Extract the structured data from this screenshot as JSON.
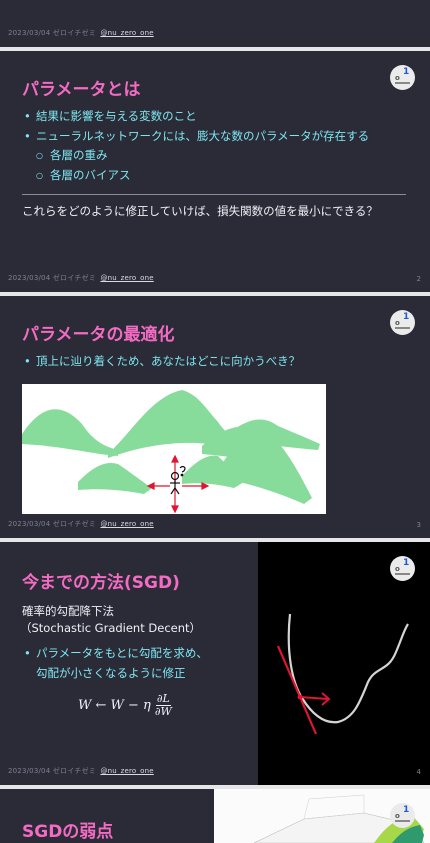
{
  "footer": {
    "date": "2023/03/04",
    "org": "ゼロイチゼミ",
    "handle": "@nu_zero_one"
  },
  "slide2": {
    "title": "パラメータとは",
    "bullets": [
      "結果に影響を与える変数のこと",
      "ニューラルネットワークには、膨大な数のパラメータが存在する"
    ],
    "subbullets": [
      "各層の重み",
      "各層のバイアス"
    ],
    "question": "これらをどのように修正していけば、損失関数の値を最小にできる？",
    "page": "2"
  },
  "slide3": {
    "title": "パラメータの最適化",
    "bullet": "頂上に辿り着くため、あなたはどこに向かうべき？",
    "page": "3"
  },
  "slide4": {
    "title": "今までの方法(SGD)",
    "subtitle_line1": "確率的勾配降下法",
    "subtitle_line2": "（Stochastic Gradient Decent）",
    "bullet_line1": "パラメータをもとに勾配を求め、",
    "bullet_line2": "勾配が小さくなるように修正",
    "page": "4"
  },
  "slide5": {
    "title": "SGDの弱点"
  },
  "colors": {
    "title": "#f36bc3",
    "bullet": "#7ee6f0",
    "background": "#2a2b36",
    "arrow": "#e01530",
    "hill": "#5fd17a"
  }
}
